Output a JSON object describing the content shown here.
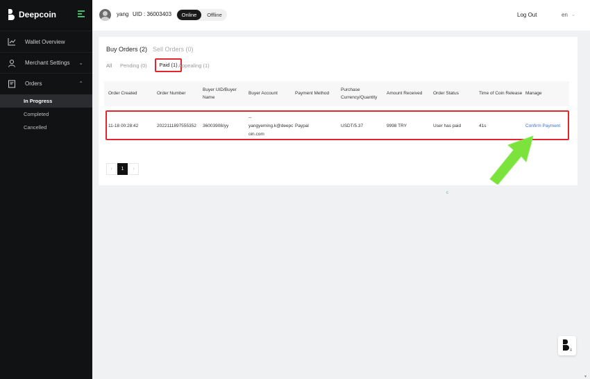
{
  "brand": {
    "name": "Deepcoin"
  },
  "sidebar": {
    "items": [
      {
        "label": "Wallet Overview",
        "icon": "chart-icon"
      },
      {
        "label": "Merchant Settings",
        "icon": "user-icon"
      },
      {
        "label": "Orders",
        "icon": "document-icon"
      }
    ],
    "orders_sub": [
      "In Progress",
      "Completed",
      "Cancelled"
    ]
  },
  "header": {
    "username": "yang",
    "uid": "UID : 36003403",
    "online_label": "Online",
    "offline_label": "Offline",
    "logout_label": "Log Out",
    "language": "en"
  },
  "orders": {
    "primary_tabs": {
      "buy": "Buy Orders (2)",
      "sell": "Sell Orders (0)"
    },
    "status_tabs": {
      "all": "All",
      "pending": "Pending (0)",
      "paid": "Paid (1)",
      "appealing": "Appealing (1)"
    },
    "columns": {
      "created": "Order Created",
      "number": "Order Number",
      "buyer_uid": "Buyer UID/Buyer Name",
      "buyer_account": "Buyer Account",
      "payment": "Payment Method",
      "purchase": "Purchase Currency/Quantity",
      "amount": "Amount Received",
      "status": "Order Status",
      "release": "Time of Coin Release",
      "manage": "Manage"
    },
    "rows": [
      {
        "created": "11-18 00:28:42",
        "number": "2022111897555352",
        "buyer_uid": "36003908/yy",
        "buyer_account_dash": "--",
        "buyer_account_1": "yangyeming.k@deepc",
        "buyer_account_2": "oin.com",
        "payment": "Paypal",
        "purchase": "USDT/5.37",
        "amount": "9998 TRY",
        "status": "User has paid",
        "release": "41s",
        "manage": "Confirm Payment"
      }
    ],
    "pagination": {
      "prev": "‹",
      "current": "1",
      "next": "›"
    }
  },
  "loading_mark": "c",
  "colors": {
    "highlight": "#e3262d",
    "arrow": "#7be33b",
    "link": "#3d6fd6",
    "sidebar_bg": "#111214"
  }
}
